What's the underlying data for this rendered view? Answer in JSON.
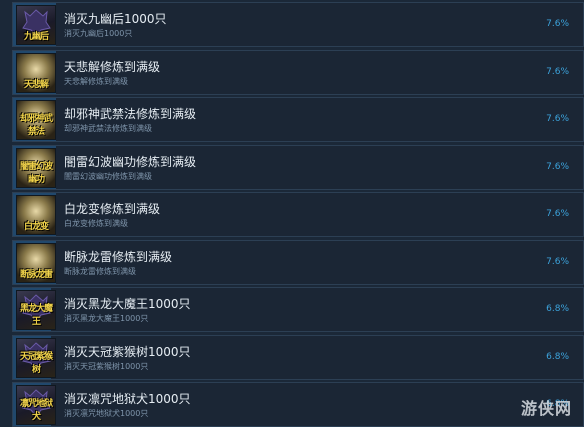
{
  "colors": {
    "background": "#1b2838",
    "row_bg": "#1b2635",
    "progress_fill": "#255a8a",
    "title_text": "#e6edf3",
    "desc_text": "#7f95ab",
    "percent_text": "#3ca3dc"
  },
  "achievements": [
    {
      "title": "消灭九幽后1000只",
      "desc": "消灭九幽后1000只",
      "percent": "7.6%",
      "fill": 0.076,
      "icon": "demon-icon",
      "glyph": "九幽后",
      "dark": true
    },
    {
      "title": "天悲解修炼到满级",
      "desc": "天悲解修炼到满级",
      "percent": "7.6%",
      "fill": 0.076,
      "icon": "orb-icon",
      "glyph": "天悲解",
      "dark": false
    },
    {
      "title": "却邪神武禁法修炼到满级",
      "desc": "却邪神武禁法修炼到满级",
      "percent": "7.6%",
      "fill": 0.076,
      "icon": "orb-icon",
      "glyph": "却邪神武禁法",
      "dark": false
    },
    {
      "title": "闇雷幻波幽功修炼到满级",
      "desc": "闇雷幻波幽功修炼到满级",
      "percent": "7.6%",
      "fill": 0.076,
      "icon": "orb-icon",
      "glyph": "闇雷幻波幽功",
      "dark": false
    },
    {
      "title": "白龙变修炼到满级",
      "desc": "白龙变修炼到满级",
      "percent": "7.6%",
      "fill": 0.076,
      "icon": "orb-icon",
      "glyph": "白龙变",
      "dark": false
    },
    {
      "title": "断脉龙雷修炼到满级",
      "desc": "断脉龙雷修炼到满级",
      "percent": "7.6%",
      "fill": 0.076,
      "icon": "orb-icon",
      "glyph": "断脉龙雷",
      "dark": false
    },
    {
      "title": "消灭黑龙大魔王1000只",
      "desc": "消灭黑龙大魔王1000只",
      "percent": "6.8%",
      "fill": 0.068,
      "icon": "demon-icon",
      "glyph": "黑龙大魔王",
      "dark": true
    },
    {
      "title": "消灭天冠紫猴树1000只",
      "desc": "消灭天冠紫猴树1000只",
      "percent": "6.8%",
      "fill": 0.068,
      "icon": "demon-icon",
      "glyph": "天冠紫猴树",
      "dark": true
    },
    {
      "title": "消灭凛咒地狱犬1000只",
      "desc": "消灭凛咒地狱犬1000只",
      "percent": "6.8%",
      "fill": 0.068,
      "icon": "demon-icon",
      "glyph": "凛咒地狱犬",
      "dark": true
    }
  ],
  "watermark": "游侠网"
}
